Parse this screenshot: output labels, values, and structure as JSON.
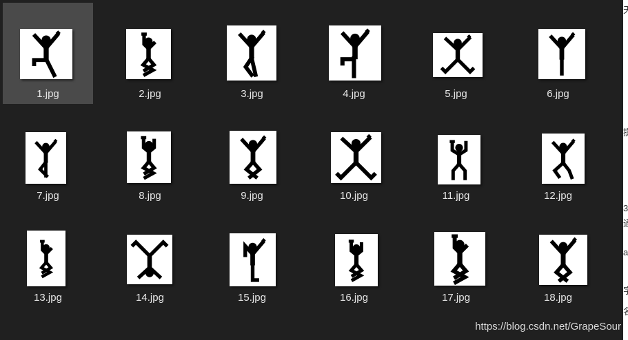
{
  "files": [
    {
      "name": "1.jpg",
      "selected": true,
      "pose": "l2"
    },
    {
      "name": "2.jpg",
      "pose": "z"
    },
    {
      "name": "3.jpg",
      "pose": "k"
    },
    {
      "name": "4.jpg",
      "pose": "l"
    },
    {
      "name": "5.jpg",
      "pose": "x"
    },
    {
      "name": "6.jpg",
      "pose": "y"
    },
    {
      "name": "7.jpg",
      "pose": "k2"
    },
    {
      "name": "8.jpg",
      "pose": "z2"
    },
    {
      "name": "9.jpg",
      "pose": "d"
    },
    {
      "name": "10.jpg",
      "pose": "x2"
    },
    {
      "name": "11.jpg",
      "pose": "h"
    },
    {
      "name": "12.jpg",
      "pose": "w"
    },
    {
      "name": "13.jpg",
      "pose": "z"
    },
    {
      "name": "14.jpg",
      "pose": "inv"
    },
    {
      "name": "15.jpg",
      "pose": "l3"
    },
    {
      "name": "16.jpg",
      "pose": "z2"
    },
    {
      "name": "17.jpg",
      "pose": "z"
    },
    {
      "name": "18.jpg",
      "pose": "d"
    }
  ],
  "edge_glyphs": [
    "天",
    "提",
    "3",
    "通",
    "a",
    "字",
    "名"
  ],
  "watermark": "https://blog.csdn.net/GrapeSour",
  "colors": {
    "background": "#202020",
    "selected": "#4a4a4a",
    "label": "#e6e6e6",
    "thumb": "#ffffff",
    "figure": "#000000"
  },
  "icons": {
    "thumbnail": "stick-figure-image"
  }
}
